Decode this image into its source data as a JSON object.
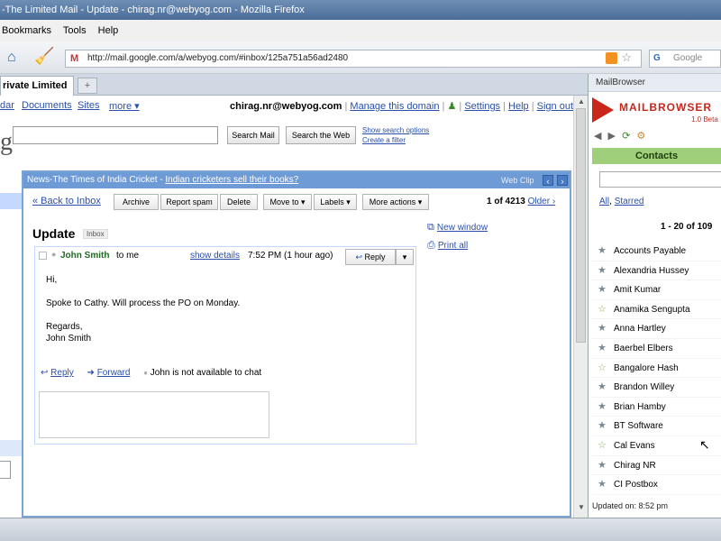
{
  "window": {
    "title": "-The Limited Mail - Update - chirag.nr@webyog.com - Mozilla Firefox"
  },
  "menu": [
    "Bookmarks",
    "Tools",
    "Help"
  ],
  "browser": {
    "url": "http://mail.google.com/a/webyog.com/#inbox/125a751a56ad2480",
    "search_placeholder": "Google",
    "tab_label": "rivate Limited ...",
    "new_tab": "+"
  },
  "gmail": {
    "nav": [
      "dar",
      "Documents",
      "Sites",
      "more ▾"
    ],
    "user_email": "chirag.nr@webyog.com",
    "user_links": [
      "Manage this domain",
      "Settings",
      "Help",
      "Sign out"
    ],
    "search_mail_btn": "Search Mail",
    "search_web_btn": "Search the Web",
    "show_search_options": "Show search options",
    "create_filter": "Create a filter",
    "big_letter": "g"
  },
  "popup": {
    "header_prefix": "News-The Times of India Cricket - ",
    "header_link": "Indian cricketers sell their books?",
    "web_clip": "Web Clip",
    "back_to_inbox": "« Back to Inbox",
    "buttons": [
      "Archive",
      "Report spam",
      "Delete",
      "Move to ▾",
      "Labels ▾",
      "More actions ▾"
    ],
    "count": "1 of 4213",
    "older": "Older ›",
    "subject": "Update",
    "inbox_label": "Inbox",
    "new_window": "New window",
    "print_all": "Print all",
    "sender": "John Smith",
    "to": "to me",
    "show_details": "show details",
    "time": "7:52 PM (1 hour ago)",
    "reply_btn": "Reply",
    "body": "Hi,\n\nSpoke to Cathy. Will process the PO on Monday.\n\nRegards,\nJohn Smith",
    "reply_link": "Reply",
    "forward_link": "Forward",
    "chat_status": "John is not available to chat"
  },
  "mailbrowser": {
    "title": "MailBrowser",
    "logo_text": "MAILBROWSER",
    "version": "1.0 Beta",
    "contacts_tab": "Contacts",
    "filter_all": "All",
    "filter_starred": "Starred",
    "range": "1 - 20 of 109",
    "contacts": [
      {
        "name": "Accounts Payable",
        "starred": true
      },
      {
        "name": "Alexandria Hussey",
        "starred": true
      },
      {
        "name": "Amit Kumar",
        "starred": true
      },
      {
        "name": "Anamika Sengupta",
        "starred": false
      },
      {
        "name": "Anna Hartley",
        "starred": true
      },
      {
        "name": "Baerbel Elbers",
        "starred": true
      },
      {
        "name": "Bangalore Hash",
        "starred": false
      },
      {
        "name": "Brandon Willey",
        "starred": true
      },
      {
        "name": "Brian Hamby",
        "starred": true
      },
      {
        "name": "BT Software",
        "starred": true
      },
      {
        "name": "Cal Evans",
        "starred": false
      },
      {
        "name": "Chirag NR",
        "starred": true
      },
      {
        "name": "CI Postbox",
        "starred": true
      }
    ],
    "updated": "Updated on: 8:52 pm"
  }
}
